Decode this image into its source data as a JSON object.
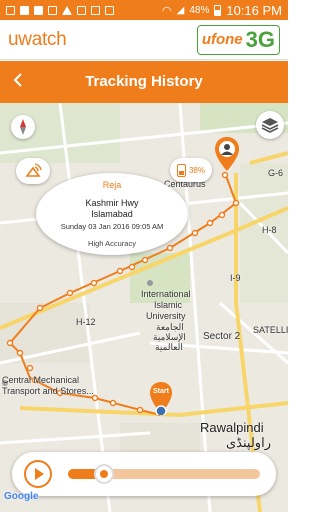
{
  "status_bar": {
    "battery": "48%",
    "time": "10:16 PM",
    "brand_color": "#ef7d1b"
  },
  "brand": {
    "app_logo": "uwatch",
    "carrier_name": "ufone",
    "carrier_network": "3G"
  },
  "header": {
    "back_icon": "chevron-left-icon",
    "title": "Tracking History"
  },
  "map": {
    "labels": {
      "g6": "G-6",
      "h8": "H-8",
      "i9": "I-9",
      "h12": "H-12",
      "centaurus": "Centaurus",
      "uni1": "International",
      "uni2": "Islamic",
      "uni3": "University",
      "uni_ar1": "الجامعة",
      "uni_ar2": "الإسلامية",
      "uni_ar3": "العالمية",
      "sector2": "Sector 2",
      "satellite": "SATELLI",
      "cmt1": "Central Mechanical",
      "cmt2": "Transport and Stores...",
      "rawalpindi": "Rawalpindi",
      "rawalpindi_ur": "راولپنڈی",
      "google": "Google"
    },
    "battery_badge": "38%",
    "start_label": "Start",
    "info_window": {
      "name": "Reja",
      "address_line1": "Kashmir Hwy",
      "address_line2": "Islamabad",
      "timestamp": "Sunday 03 Jan 2016 09:05 AM",
      "accuracy": "High Accuracy"
    }
  },
  "playback": {
    "progress": 0.19,
    "accent": "#ef7d1b",
    "track_color": "#f3c79b"
  }
}
